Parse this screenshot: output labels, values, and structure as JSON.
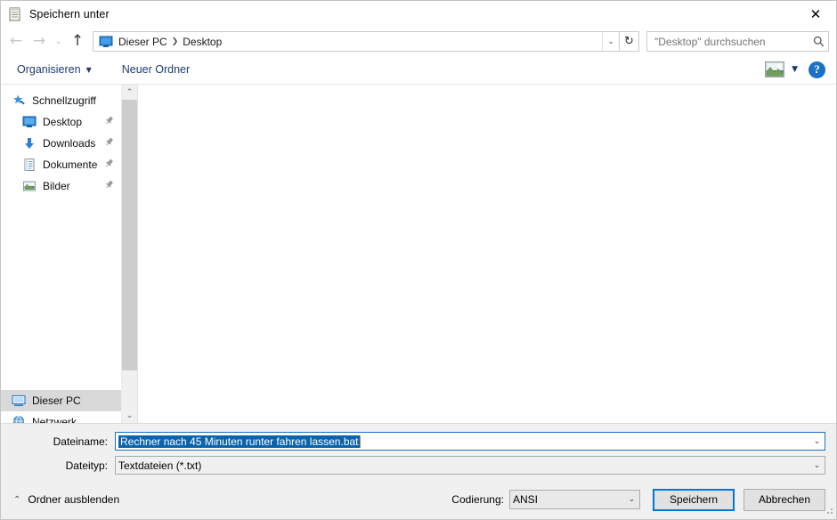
{
  "window": {
    "title": "Speichern unter",
    "title_icon": "notepad-icon",
    "close_label": "✕"
  },
  "nav": {
    "back_icon": "arrow-left-icon",
    "forward_icon": "arrow-right-icon",
    "recent_icon": "chevron-down-icon",
    "up_icon": "arrow-up-icon",
    "back_glyph": "←",
    "forward_glyph": "→",
    "up_glyph": "↑",
    "recent_glyph": "⌄",
    "breadcrumb": {
      "location_icon": "desktop-monitor-icon",
      "items": [
        "Dieser PC",
        "Desktop"
      ],
      "separator": "❯"
    },
    "dropdown_glyph": "⌄",
    "refresh_glyph": "↻",
    "refresh_icon": "refresh-icon"
  },
  "search": {
    "placeholder": "\"Desktop\" durchsuchen",
    "value": "",
    "icon": "search-icon"
  },
  "toolbar": {
    "organize_label": "Organisieren",
    "organize_caret": "▼",
    "new_folder_label": "Neuer Ordner",
    "view_icon": "picture-view-icon",
    "view_caret": "▼",
    "help_label": "?",
    "help_icon": "help-circle-icon"
  },
  "sidebar": {
    "items": [
      {
        "label": "Schnellzugriff",
        "icon": "star-pin-icon",
        "level": 0,
        "pinned": false,
        "selected": false
      },
      {
        "label": "Desktop",
        "icon": "desktop-monitor-icon",
        "level": 1,
        "pinned": true,
        "selected": false
      },
      {
        "label": "Downloads",
        "icon": "downloads-arrow-icon",
        "level": 1,
        "pinned": true,
        "selected": false
      },
      {
        "label": "Dokumente",
        "icon": "documents-icon",
        "level": 1,
        "pinned": true,
        "selected": false
      },
      {
        "label": "Bilder",
        "icon": "pictures-icon",
        "level": 1,
        "pinned": true,
        "selected": false
      }
    ],
    "bottom_items": [
      {
        "label": "Dieser PC",
        "icon": "this-pc-icon",
        "level": 0,
        "pinned": false,
        "selected": true
      },
      {
        "label": "Netzwerk",
        "icon": "network-icon",
        "level": 0,
        "pinned": false,
        "selected": false
      }
    ],
    "pin_glyph": "📌",
    "scroll_up_glyph": "⌃",
    "scroll_down_glyph": "⌄"
  },
  "form": {
    "filename_label": "Dateiname:",
    "filename_value": "Rechner nach 45 Minuten runter fahren lassen.bat",
    "filename_selected": true,
    "filetype_label": "Dateityp:",
    "filetype_value": "Textdateien (*.txt)",
    "combo_caret": "⌄"
  },
  "footer": {
    "hide_folders_label": "Ordner ausblenden",
    "hide_folders_caret": "⌃",
    "encoding_label": "Codierung:",
    "encoding_value": "ANSI",
    "save_label": "Speichern",
    "cancel_label": "Abbrechen"
  },
  "colors": {
    "accent": "#0078d7",
    "selection": "#0a64ad",
    "toolbar_text": "#1f3b6e",
    "panel": "#f0f0f0"
  }
}
